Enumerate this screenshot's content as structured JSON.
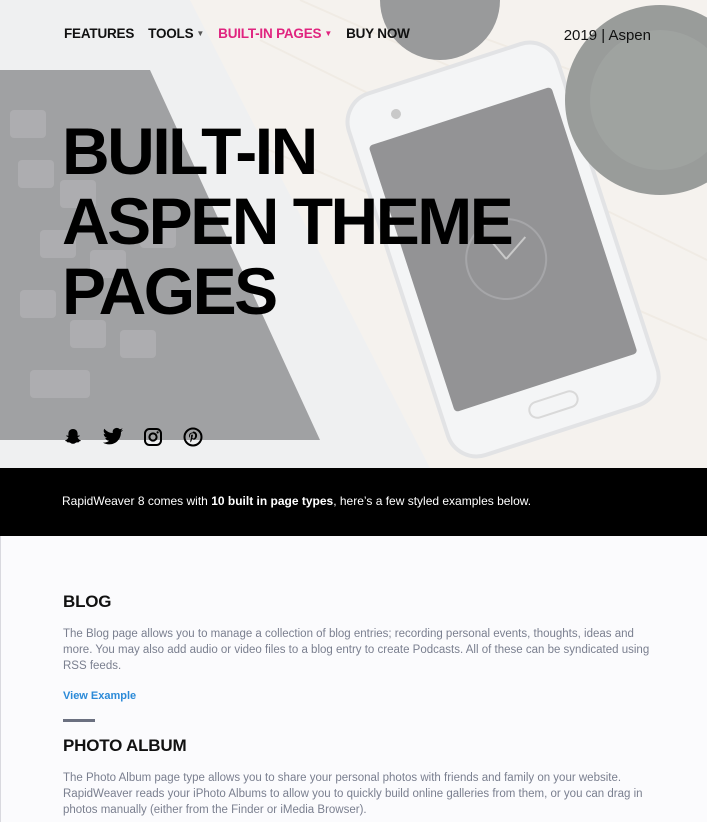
{
  "nav": {
    "items": [
      {
        "label": "FEATURES",
        "dropdown": false,
        "active": false
      },
      {
        "label": "TOOLS",
        "dropdown": true,
        "active": false
      },
      {
        "label": "BUILT-IN PAGES",
        "dropdown": true,
        "active": true
      },
      {
        "label": "BUY NOW",
        "dropdown": false,
        "active": false
      }
    ],
    "brand": "2019 | Aspen",
    "caret": "▼"
  },
  "hero": {
    "title_lines": [
      "BUILT-IN",
      "ASPEN THEME",
      "PAGES"
    ],
    "social_icons": [
      "snapchat-icon",
      "twitter-icon",
      "instagram-icon",
      "pinterest-icon"
    ]
  },
  "band": {
    "text_before": "RapidWeaver 8 comes with ",
    "text_bold": "10 built in page types",
    "text_after": ", here’s a few styled examples below."
  },
  "sections": [
    {
      "title": "BLOG",
      "text": "The Blog page allows you to manage a collection of blog entries; recording personal events, thoughts, ideas and more. You may also add audio or video files to a blog entry to create Podcasts. All of these can be syndicated using RSS feeds.",
      "link": "View Example"
    },
    {
      "title": "PHOTO ALBUM",
      "text": "The Photo Album page type allows you to share your personal photos with friends and family on your website. RapidWeaver reads your iPhoto Albums to allow you to quickly build online galleries from them, or you can drag in photos manually (either from the Finder or iMedia Browser)."
    }
  ],
  "colors": {
    "accent": "#e0247f",
    "link": "#2b8ad8",
    "band": "#000000",
    "body_text": "#7a7f8f"
  }
}
